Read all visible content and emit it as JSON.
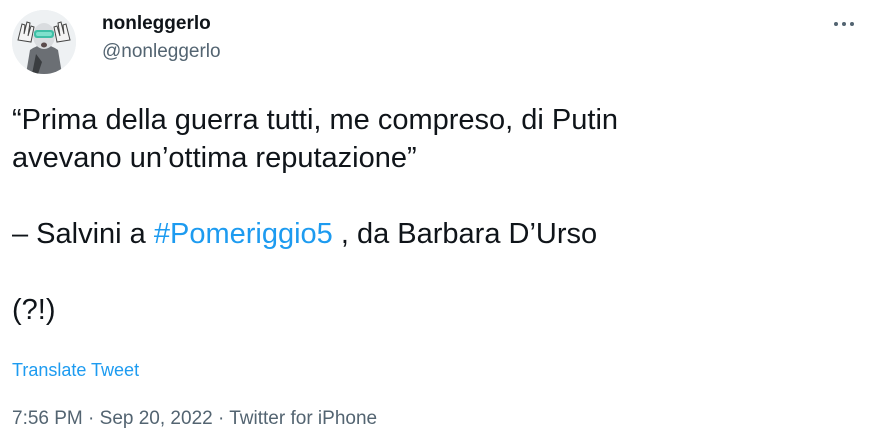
{
  "author": {
    "display_name": "nonleggerlo",
    "handle": "@nonleggerlo"
  },
  "tweet": {
    "line1": "“Prima della guerra tutti, me compreso, di Putin",
    "line2": "avevano un’ottima reputazione”",
    "quote_prefix": "– Salvini a ",
    "hashtag": "#Pomeriggio5",
    "quote_suffix": " , da Barbara D’Urso",
    "closing": "(?!)"
  },
  "translate_label": "Translate Tweet",
  "meta": {
    "time": "7:56 PM",
    "separator": " · ",
    "date": "Sep 20, 2022",
    "source": "Twitter for iPhone"
  },
  "colors": {
    "text": "#0f1419",
    "secondary": "#536471",
    "link": "#1d9bf0"
  },
  "icons": {
    "more": "more-horizontal-icon"
  }
}
